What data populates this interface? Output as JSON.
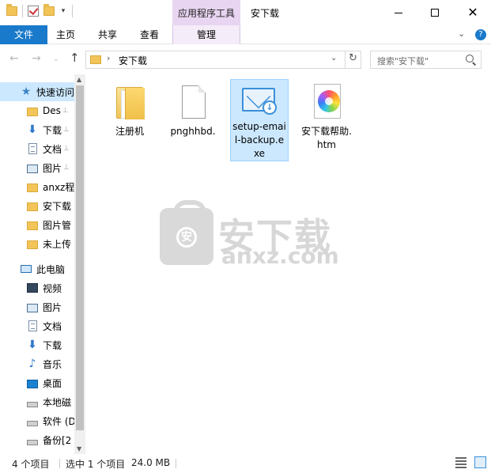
{
  "titlebar": {
    "tool_tab": "应用程序工具",
    "title": "安下载",
    "close_glyph": "✕"
  },
  "ribbon": {
    "file": "文件",
    "home": "主页",
    "share": "共享",
    "view": "查看",
    "manage": "管理",
    "expand_glyph": "⌄",
    "help_glyph": "?"
  },
  "nav": {
    "back": "←",
    "forward": "→",
    "recent": "⌄",
    "up": "↑",
    "breadcrumb_sep": "›",
    "path": "安下载",
    "refresh": "↻",
    "search_placeholder": "搜索\"安下载\""
  },
  "sidebar": {
    "items": [
      {
        "label": "快速访问",
        "icon": "star-icon",
        "pinned": false
      },
      {
        "label": "Des",
        "icon": "folder-icon",
        "pinned": true
      },
      {
        "label": "下载",
        "icon": "download-icon",
        "pinned": true
      },
      {
        "label": "文档",
        "icon": "document-icon",
        "pinned": true
      },
      {
        "label": "图片",
        "icon": "picture-icon",
        "pinned": true
      },
      {
        "label": "anxz程",
        "icon": "folder-icon",
        "pinned": false
      },
      {
        "label": "安下载",
        "icon": "folder-icon",
        "pinned": false
      },
      {
        "label": "图片管",
        "icon": "folder-icon",
        "pinned": false
      },
      {
        "label": "未上传",
        "icon": "folder-icon",
        "pinned": false
      },
      {
        "label": "此电脑",
        "icon": "computer-icon",
        "pinned": false
      },
      {
        "label": "视频",
        "icon": "video-icon",
        "pinned": false
      },
      {
        "label": "图片",
        "icon": "picture-icon",
        "pinned": false
      },
      {
        "label": "文档",
        "icon": "document-icon",
        "pinned": false
      },
      {
        "label": "下载",
        "icon": "download-icon",
        "pinned": false
      },
      {
        "label": "音乐",
        "icon": "music-icon",
        "pinned": false
      },
      {
        "label": "桌面",
        "icon": "desktop-icon",
        "pinned": false
      },
      {
        "label": "本地磁",
        "icon": "drive-icon",
        "pinned": false
      },
      {
        "label": "软件 (D",
        "icon": "drive-icon",
        "pinned": false
      },
      {
        "label": "备份[2",
        "icon": "drive-icon",
        "pinned": false
      }
    ],
    "pin_glyph": "📌"
  },
  "files": [
    {
      "name": "注册机",
      "icon": "folder-icon"
    },
    {
      "name": "pnghhbd.",
      "icon": "blank-file-icon"
    },
    {
      "name": "setup-email-backup.exe",
      "icon": "email-backup-app-icon"
    },
    {
      "name": "安下载帮助.htm",
      "icon": "htm-file-icon"
    }
  ],
  "watermark": {
    "cn": "安下载",
    "en": "anxz.com",
    "badge": "安"
  },
  "status": {
    "count": "4 个项目",
    "selection": "选中 1 个项目",
    "size": "24.0 MB"
  },
  "colors": {
    "file_tab": "#1979ca",
    "tool_tab": "#e8d5f1",
    "selection": "#cce8ff"
  }
}
